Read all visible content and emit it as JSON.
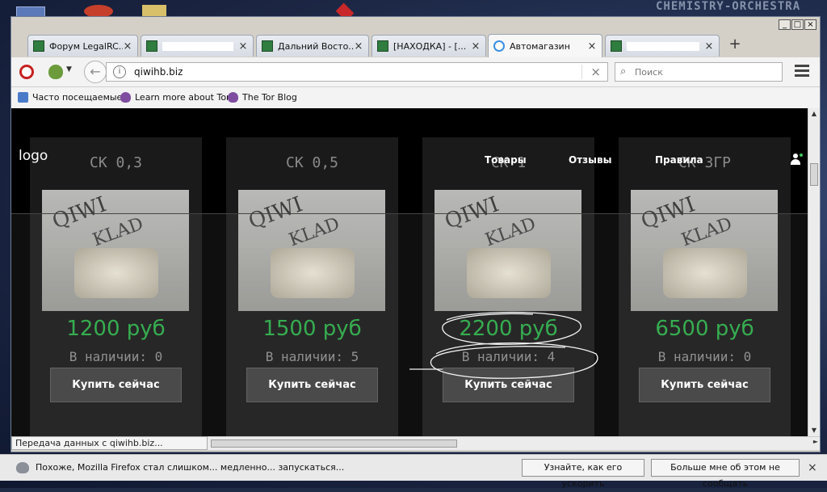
{
  "browser": {
    "tabs": [
      {
        "title": "Форум LegalRC...",
        "redacted": false,
        "active": false
      },
      {
        "title": "",
        "redacted": true,
        "active": false
      },
      {
        "title": "Дальний Восто...",
        "redacted": false,
        "active": false
      },
      {
        "title": "[НАХОДКА] - [...",
        "redacted": false,
        "active": false
      },
      {
        "title": "Автомагазин",
        "redacted": false,
        "active": true
      },
      {
        "title": "",
        "redacted": true,
        "active": false
      }
    ],
    "new_tab_label": "+",
    "url": "qiwihb.biz",
    "search_placeholder": "Поиск",
    "bookmarks": [
      {
        "label": "Часто посещаемые",
        "icon": "folder-icon"
      },
      {
        "label": "Learn more about Tor",
        "icon": "onion-icon"
      },
      {
        "label": "The Tor Blog",
        "icon": "onion-icon"
      }
    ],
    "status_text": "Передача данных с qiwihb.biz..."
  },
  "site": {
    "logo": "logo",
    "nav": [
      "Товары",
      "Отзывы",
      "Правила"
    ],
    "products": [
      {
        "title": "СК 0,3",
        "wm1": "QIWI",
        "wm2": "KLAD",
        "price": "1200 руб",
        "stock": "В наличии: 0",
        "buy_label": "Купить сейчас"
      },
      {
        "title": "СК 0,5",
        "wm1": "QIWI",
        "wm2": "KLAD",
        "price": "1500 руб",
        "stock": "В наличии: 5",
        "buy_label": "Купить сейчас"
      },
      {
        "title": "СК 1",
        "wm1": "QIWI",
        "wm2": "KLAD",
        "price": "2200 руб",
        "stock": "В наличии: 4",
        "buy_label": "Купить сейчас"
      },
      {
        "title": "СК 3ГР",
        "wm1": "QIWI",
        "wm2": "KLAD",
        "price": "6500 руб",
        "stock": "В наличии: 0",
        "buy_label": "Купить сейчас"
      }
    ],
    "colors": {
      "price": "#2aa846",
      "card_bg": "#1a1a1a",
      "page_bg": "#000000"
    }
  },
  "notification": {
    "text": "Похоже, Mozilla Firefox стал слишком... медленно... запускаться...",
    "button_primary": "Узнайте, как его ускорить",
    "button_secondary": "Больше мне об этом не сообщать",
    "close_label": "×"
  },
  "desktop": {
    "watermark": "CHEMISTRY-ORCHESTRA"
  }
}
